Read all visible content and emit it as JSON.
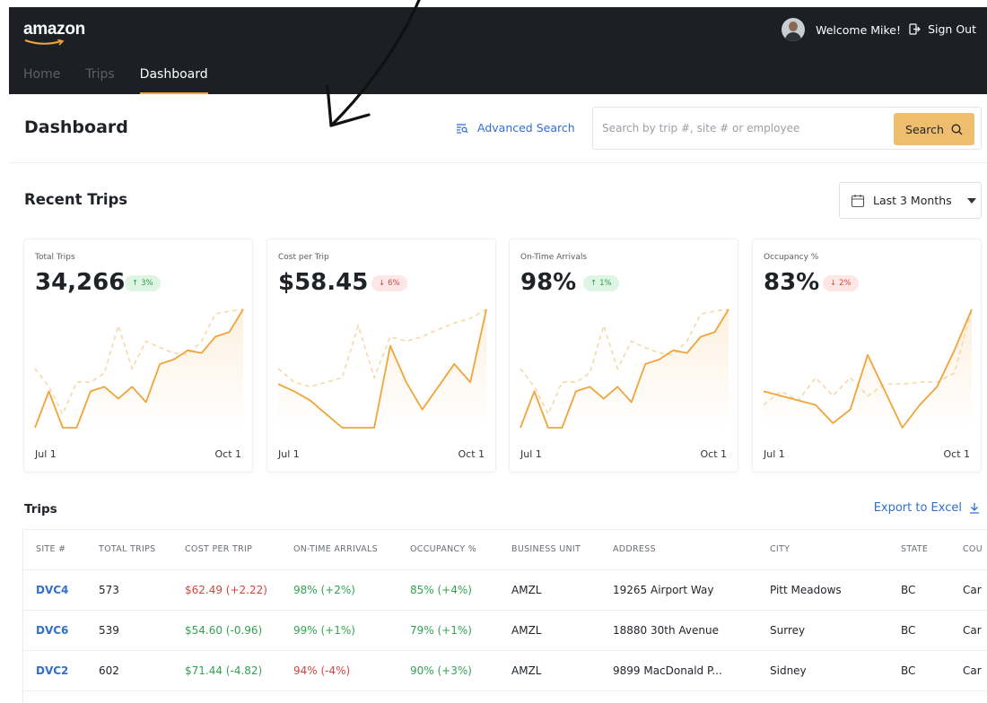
{
  "header": {
    "brand": "amazon",
    "nav": [
      "Home",
      "Trips",
      "Dashboard"
    ],
    "active_nav": "Dashboard",
    "welcome": "Welcome Mike!",
    "sign_out": "Sign Out"
  },
  "page": {
    "title": "Dashboard",
    "advanced_search": "Advanced Search",
    "search_placeholder": "Search by trip #, site # or employee",
    "search_button": "Search"
  },
  "recent": {
    "title": "Recent Trips",
    "range": "Last 3 Months"
  },
  "colors": {
    "accent": "#f0a43a",
    "link": "#2f6fd0",
    "positive": "#31a352",
    "negative": "#d6453d"
  },
  "cards": [
    {
      "label": "Total Trips",
      "value": "34,266",
      "change": "3%",
      "direction": "up",
      "x_start": "Jul 1",
      "x_end": "Oct 1"
    },
    {
      "label": "Cost per Trip",
      "value": "$58.45",
      "change": "6%",
      "direction": "down",
      "x_start": "Jul 1",
      "x_end": "Oct 1"
    },
    {
      "label": "On-Time Arrivals",
      "value": "98%",
      "change": "1%",
      "direction": "up",
      "x_start": "Jul 1",
      "x_end": "Oct 1"
    },
    {
      "label": "Occupancy %",
      "value": "83%",
      "change": "2%",
      "direction": "down",
      "x_start": "Jul 1",
      "x_end": "Oct 1"
    }
  ],
  "chart_data": [
    {
      "type": "line",
      "x": [
        "Jul 1",
        "Oct 1"
      ],
      "series": [
        {
          "values": [
            0,
            40,
            0,
            0,
            40,
            45,
            32,
            45,
            28,
            70,
            75,
            85,
            82,
            100,
            105,
            130
          ]
        },
        {
          "values": [
            65,
            45,
            15,
            50,
            50,
            60,
            112,
            65,
            95,
            88,
            82,
            80,
            95,
            125,
            128,
            130
          ]
        }
      ]
    },
    {
      "type": "line",
      "x": [
        "Jul 1",
        "Oct 1"
      ],
      "series": [
        {
          "values": [
            48,
            40,
            30,
            15,
            0,
            0,
            0,
            90,
            50,
            20,
            45,
            70,
            50,
            130
          ]
        },
        {
          "values": [
            65,
            50,
            45,
            50,
            55,
            112,
            55,
            100,
            95,
            100,
            108,
            115,
            120,
            130
          ]
        }
      ]
    },
    {
      "type": "line",
      "x": [
        "Jul 1",
        "Oct 1"
      ],
      "series": [
        {
          "values": [
            0,
            40,
            0,
            0,
            40,
            45,
            32,
            45,
            28,
            70,
            75,
            85,
            82,
            100,
            105,
            130
          ]
        },
        {
          "values": [
            65,
            45,
            15,
            50,
            50,
            60,
            112,
            65,
            95,
            88,
            82,
            80,
            95,
            125,
            128,
            130
          ]
        }
      ]
    },
    {
      "type": "line",
      "x": [
        "Jul 1",
        "Oct 1"
      ],
      "series": [
        {
          "values": [
            40,
            35,
            30,
            25,
            5,
            20,
            80,
            40,
            0,
            25,
            45,
            85,
            130
          ]
        },
        {
          "values": [
            25,
            40,
            30,
            55,
            35,
            55,
            35,
            48,
            48,
            50,
            50,
            60,
            130
          ]
        }
      ]
    }
  ],
  "trips": {
    "title": "Trips",
    "export": "Export to Excel",
    "columns": [
      "SITE #",
      "TOTAL TRIPS",
      "COST PER TRIP",
      "ON-TIME ARRIVALS",
      "OCCUPANCY %",
      "BUSINESS UNIT",
      "ADDRESS",
      "CITY",
      "STATE",
      "COU"
    ],
    "rows": [
      {
        "site": "DVC4",
        "total": "573",
        "cost": "$62.49 (+2.22)",
        "cost_dir": "neg",
        "ontime": "98% (+2%)",
        "ontime_dir": "pos",
        "occupancy": "85% (+4%)",
        "occ_dir": "pos",
        "unit": "AMZL",
        "address": "19265 Airport Way",
        "city": "Pitt Meadows",
        "state": "BC",
        "country": "Car"
      },
      {
        "site": "DVC6",
        "total": "539",
        "cost": "$54.60 (-0.96)",
        "cost_dir": "pos",
        "ontime": "99% (+1%)",
        "ontime_dir": "pos",
        "occupancy": "79% (+1%)",
        "occ_dir": "pos",
        "unit": "AMZL",
        "address": "18880 30th Avenue",
        "city": "Surrey",
        "state": "BC",
        "country": "Car"
      },
      {
        "site": "DVC2",
        "total": "602",
        "cost": "$71.44 (-4.82)",
        "cost_dir": "pos",
        "ontime": "94% (-4%)",
        "ontime_dir": "neg",
        "occupancy": "90% (+3%)",
        "occ_dir": "pos",
        "unit": "AMZL",
        "address": "9899 MacDonald P...",
        "city": "Sidney",
        "state": "BC",
        "country": "Car"
      }
    ]
  }
}
